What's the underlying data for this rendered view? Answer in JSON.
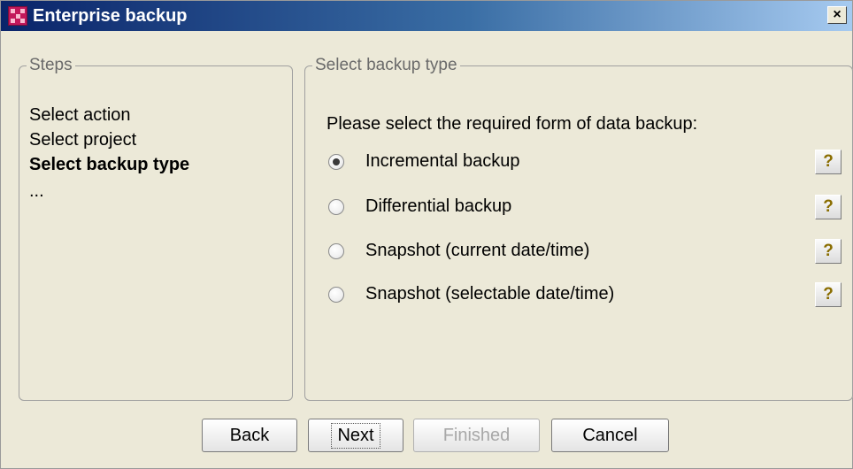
{
  "window": {
    "title": "Enterprise backup",
    "close_label": "×"
  },
  "steps": {
    "legend": "Steps",
    "items": [
      {
        "label": "Select action",
        "bold": false
      },
      {
        "label": "Select project",
        "bold": false
      },
      {
        "label": "Select backup type",
        "bold": true
      },
      {
        "label": "...",
        "bold": false
      }
    ]
  },
  "backup_type": {
    "legend": "Select backup type",
    "prompt": "Please select the required form of data backup:",
    "options": [
      {
        "label": "Incremental backup",
        "selected": true,
        "help": "?"
      },
      {
        "label": "Differential backup",
        "selected": false,
        "help": "?"
      },
      {
        "label": "Snapshot (current date/time)",
        "selected": false,
        "help": "?"
      },
      {
        "label": "Snapshot (selectable date/time)",
        "selected": false,
        "help": "?"
      }
    ]
  },
  "buttons": {
    "back": "Back",
    "next": "Next",
    "finished": "Finished",
    "cancel": "Cancel"
  },
  "colors": {
    "titlebar_start": "#0a246a",
    "titlebar_end": "#a6caf0",
    "icon": "#c2185b",
    "window_bg": "#ece9d8"
  },
  "icons": {
    "app": "enterprise-backup-icon",
    "close": "close-icon",
    "help": "help-icon"
  }
}
